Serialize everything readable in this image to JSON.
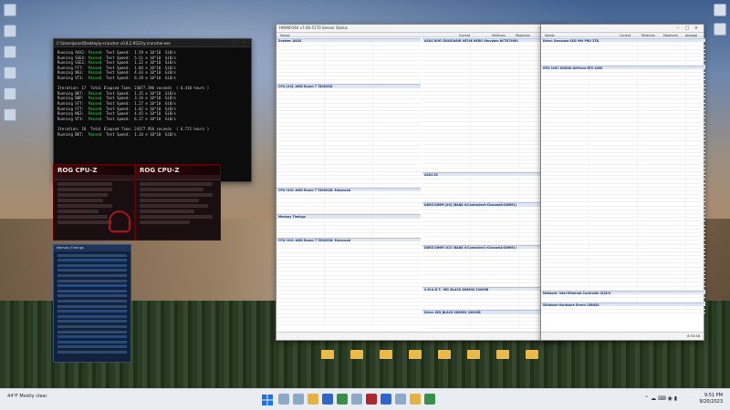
{
  "terminal": {
    "title": "C:\\Users\\jacor\\Desktop\\y-cruncher v0.8.2.9522\\y-cruncher.exe",
    "lines": [
      {
        "pre": "Running AVX2: ",
        "status": "Passed",
        "post": "  Test Speed:  1.59 e 10^10  GiB/s"
      },
      {
        "pre": "Running SSE4: ",
        "status": "Passed",
        "post": "  Test Speed:  5.51 e 10^10  GiB/s"
      },
      {
        "pre": "Running SSE2: ",
        "status": "Passed",
        "post": "  Test Speed:  1.22 e 10^10  GiB/s"
      },
      {
        "pre": "Running FFT:  ",
        "status": "Passed",
        "post": "  Test Speed:  1.04 e 10^10  GiB/s"
      },
      {
        "pre": "Running N63:  ",
        "status": "Passed",
        "post": "  Test Speed:  4.43 e 10^10  GiB/s"
      },
      {
        "pre": "Running VT3:  ",
        "status": "Passed",
        "post": "  Test Speed:  6.29 e 10^10  GiB/s"
      },
      {
        "pre": "",
        "status": "",
        "post": ""
      },
      {
        "pre": "Iteration: 17  Total Elapsed Time: 23077.190 seconds  ( 6.410 hours )",
        "status": "",
        "post": ""
      },
      {
        "pre": "Running BKT:  ",
        "status": "Passed",
        "post": "  Test Speed:  1.35 e 10^10  GiB/s"
      },
      {
        "pre": "Running BBP:  ",
        "status": "Passed",
        "post": "  Test Speed:  3.34 e 10^10  GiB/s"
      },
      {
        "pre": "Running SFT:  ",
        "status": "Passed",
        "post": "  Test Speed:  1.27 e 10^10  GiB/s"
      },
      {
        "pre": "Running FFT:  ",
        "status": "Passed",
        "post": "  Test Speed:  1.02 e 10^10  GiB/s"
      },
      {
        "pre": "Running N63:  ",
        "status": "Passed",
        "post": "  Test Speed:  4.45 e 10^10  GiB/s"
      },
      {
        "pre": "Running VT3:  ",
        "status": "Passed",
        "post": "  Test Speed:  6.27 e 10^10  GiB/s"
      },
      {
        "pre": "",
        "status": "",
        "post": ""
      },
      {
        "pre": "Iteration: 18  Total Elapsed Time: 24377.950 seconds  ( 6.772 hours )",
        "status": "",
        "post": ""
      },
      {
        "pre": "Running BKT:  ",
        "status": "Passed",
        "post": "  Test Speed:  1.34 e 10^10  GiB/s"
      }
    ]
  },
  "cpuz_left": {
    "title": "ROG CPU-Z",
    "badge": "REPUBLIC OF GAMERS"
  },
  "cpuz_right": {
    "title": "ROG CPU-Z"
  },
  "mem_panel": {
    "title": "Memory Timings"
  },
  "hwinfo_main": {
    "title": "HWiNFO64 v7.60-5170 Sensor Status",
    "columns": [
      "Sensor",
      "Current",
      "Minimum",
      "Maximum",
      "Average"
    ],
    "sections": [
      "System: ASUS",
      "CPU [#0]: AMD Ryzen 7 7800X3D",
      "CPU [#0]: AMD Ryzen 7 7800X3D: Enhanced",
      "Memory Timings",
      "CPU [#0]: AMD Ryzen 7 7800X3D: Enhanced",
      "ASUS ROG CROSSHAIR X670E HERO (Nuvoton NCT6799D)",
      "ASUS EC",
      "DDR5 DIMM [#0] (BANK 0/Controller0-ChannelA-DIMM1)",
      "DDR5 DIMM [#2] (BANK 0/Controller1-ChannelA-DIMM1)",
      "S.M.A.R.T.: WD_BLACK SN850X 2000GB",
      "Drive: WD_BLACK SN850X 2000GB",
      "S.M.A.R.T.: Samsung SSD 990 PRO 2TB"
    ]
  },
  "hwinfo_side": {
    "columns": [
      "Sensor",
      "Current",
      "Minimum",
      "Maximum",
      "Average"
    ],
    "sections": [
      "Drive: Samsung SSD 990 PRO 2TB",
      "GPU [#0]: NVIDIA GeForce RTX 4090",
      "Network: Intel Ethernet Controller I226-V",
      "Windows Hardware Errors (WHEA)"
    ],
    "status_time": "6:53:58"
  },
  "taskbar": {
    "weather": "44°F Mostly clear",
    "time": "9:51 PM",
    "date": "9/20/2023"
  }
}
